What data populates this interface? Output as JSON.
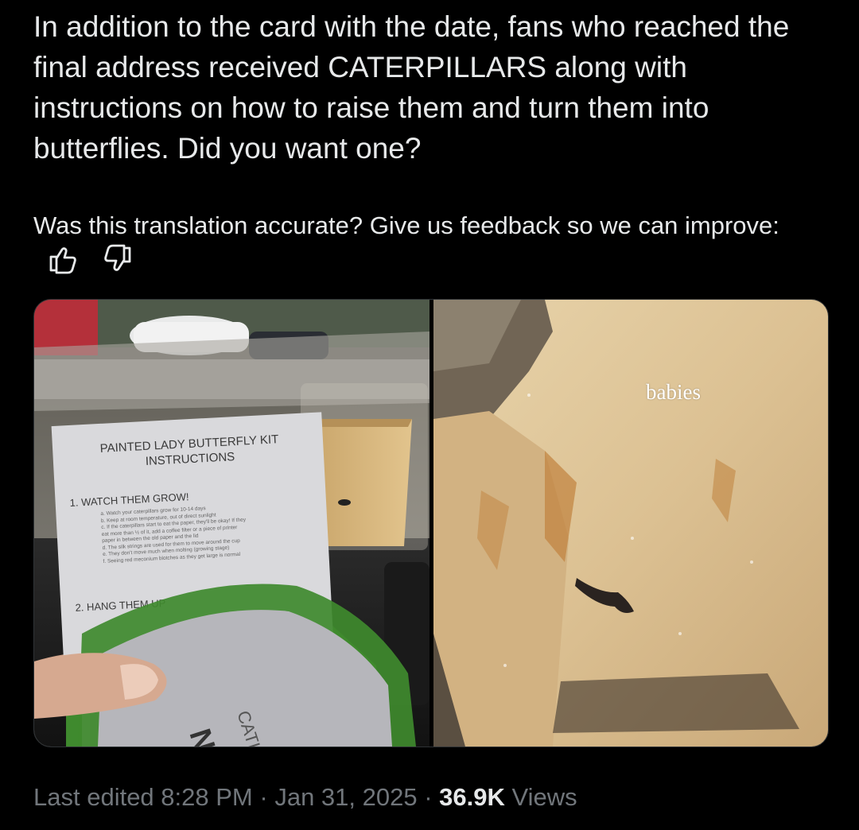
{
  "tweet": {
    "text": "In addition to the card with the date, fans who reached the final address received CATERPILLARS along with instructions on how to raise them and turn them into butterflies. Did you want one?"
  },
  "translation_feedback": {
    "prompt": "Was this translation accurate? Give us feedback so we can improve:",
    "thumbs_up_icon": "thumbs-up-icon",
    "thumbs_down_icon": "thumbs-down-icon"
  },
  "media": {
    "left_photo": {
      "kit_title_line1": "PAINTED LADY BUTTERFLY KIT",
      "kit_title_line2": "INSTRUCTIONS",
      "step1": "1.  WATCH THEM GROW!",
      "step1_lines": [
        "a.  Watch your caterpillars grow for 10-14 days",
        "b.  Keep at room temperature, out of direct sunlight",
        "c.  If the caterpillars start to eat the paper, they'll be okay! If they",
        "     eat more than ½ of it, add a coffee filter or a piece of printer",
        "     paper in between the old paper and the lid",
        "d.  The silk strings are used for them to move around the cup",
        "e.  They don't move much when molting (growing stage)",
        "f.   Seeing red meconium blotches as they get large is normal"
      ],
      "step2": "2.  HANG THEM UP",
      "sleeve_text": "NING",
      "sleeve_text2": "CATION"
    },
    "right_photo": {
      "overlay_label": "babies"
    }
  },
  "meta": {
    "edited_label": "Last edited",
    "time": "8:28 PM",
    "separator": "·",
    "date": "Jan 31, 2025",
    "views_count": "36.9K",
    "views_label": "Views"
  },
  "colors": {
    "background": "#000000",
    "primary_text": "#e7e9ea",
    "secondary_text": "#71767b",
    "border": "#2f3336"
  }
}
